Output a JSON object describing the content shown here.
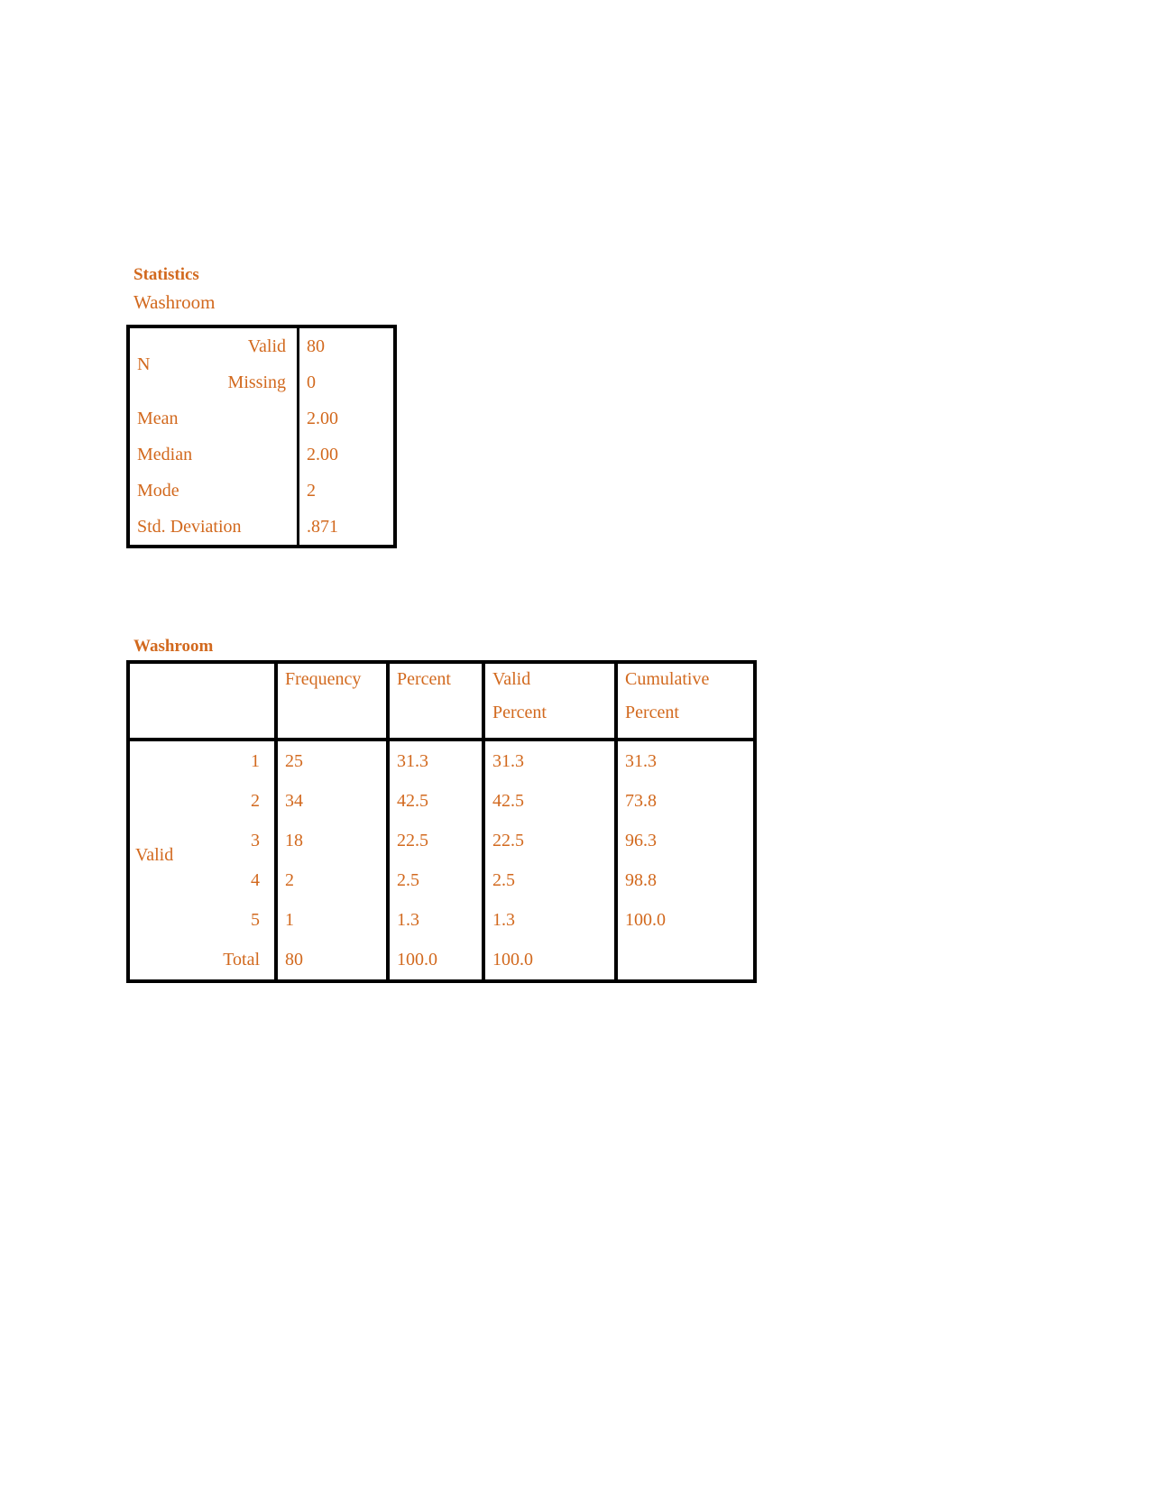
{
  "document": {
    "text_color": "#D2691E",
    "border_color": "#000000",
    "background": "#FFFFFF"
  },
  "statistics_block": {
    "title": "Statistics",
    "subtitle": "Washroom",
    "rows": [
      {
        "label": "N",
        "sublabel": "Valid",
        "value": "80"
      },
      {
        "label": "",
        "sublabel": "Missing",
        "value": "0"
      },
      {
        "label": "Mean",
        "sublabel": "",
        "value": "2.00"
      },
      {
        "label": "Median",
        "sublabel": "",
        "value": "2.00"
      },
      {
        "label": "Mode",
        "sublabel": "",
        "value": "2"
      },
      {
        "label": "Std. Deviation",
        "sublabel": "",
        "value": ".871"
      }
    ]
  },
  "frequency_block": {
    "title": "Washroom",
    "headers": {
      "corner": "",
      "frequency": "Frequency",
      "percent": "Percent",
      "valid_percent_line1": "Valid",
      "valid_percent_line2": "Percent",
      "cumulative_percent_line1": "Cumulative",
      "cumulative_percent_line2": "Percent"
    },
    "group_label": "Valid",
    "rows": [
      {
        "category": "1",
        "frequency": "25",
        "percent": "31.3",
        "valid_percent": "31.3",
        "cumulative_percent": "31.3"
      },
      {
        "category": "2",
        "frequency": "34",
        "percent": "42.5",
        "valid_percent": "42.5",
        "cumulative_percent": "73.8"
      },
      {
        "category": "3",
        "frequency": "18",
        "percent": "22.5",
        "valid_percent": "22.5",
        "cumulative_percent": "96.3"
      },
      {
        "category": "4",
        "frequency": "2",
        "percent": "2.5",
        "valid_percent": "2.5",
        "cumulative_percent": "98.8"
      },
      {
        "category": "5",
        "frequency": "1",
        "percent": "1.3",
        "valid_percent": "1.3",
        "cumulative_percent": "100.0"
      },
      {
        "category": "Total",
        "frequency": "80",
        "percent": "100.0",
        "valid_percent": "100.0",
        "cumulative_percent": ""
      }
    ]
  },
  "chart_data": {
    "type": "table",
    "title": "Washroom",
    "categories": [
      "1",
      "2",
      "3",
      "4",
      "5"
    ],
    "series": [
      {
        "name": "Frequency",
        "values": [
          25,
          34,
          18,
          2,
          1
        ]
      },
      {
        "name": "Percent",
        "values": [
          31.3,
          42.5,
          22.5,
          2.5,
          1.3
        ]
      },
      {
        "name": "Valid Percent",
        "values": [
          31.3,
          42.5,
          22.5,
          2.5,
          1.3
        ]
      },
      {
        "name": "Cumulative Percent",
        "values": [
          31.3,
          73.8,
          96.3,
          98.8,
          100.0
        ]
      }
    ],
    "totals": {
      "frequency": 80,
      "percent": 100.0,
      "valid_percent": 100.0
    },
    "descriptives": {
      "n_valid": 80,
      "n_missing": 0,
      "mean": 2.0,
      "median": 2.0,
      "mode": 2,
      "std_deviation": 0.871
    },
    "xlabel": "",
    "ylabel": ""
  }
}
